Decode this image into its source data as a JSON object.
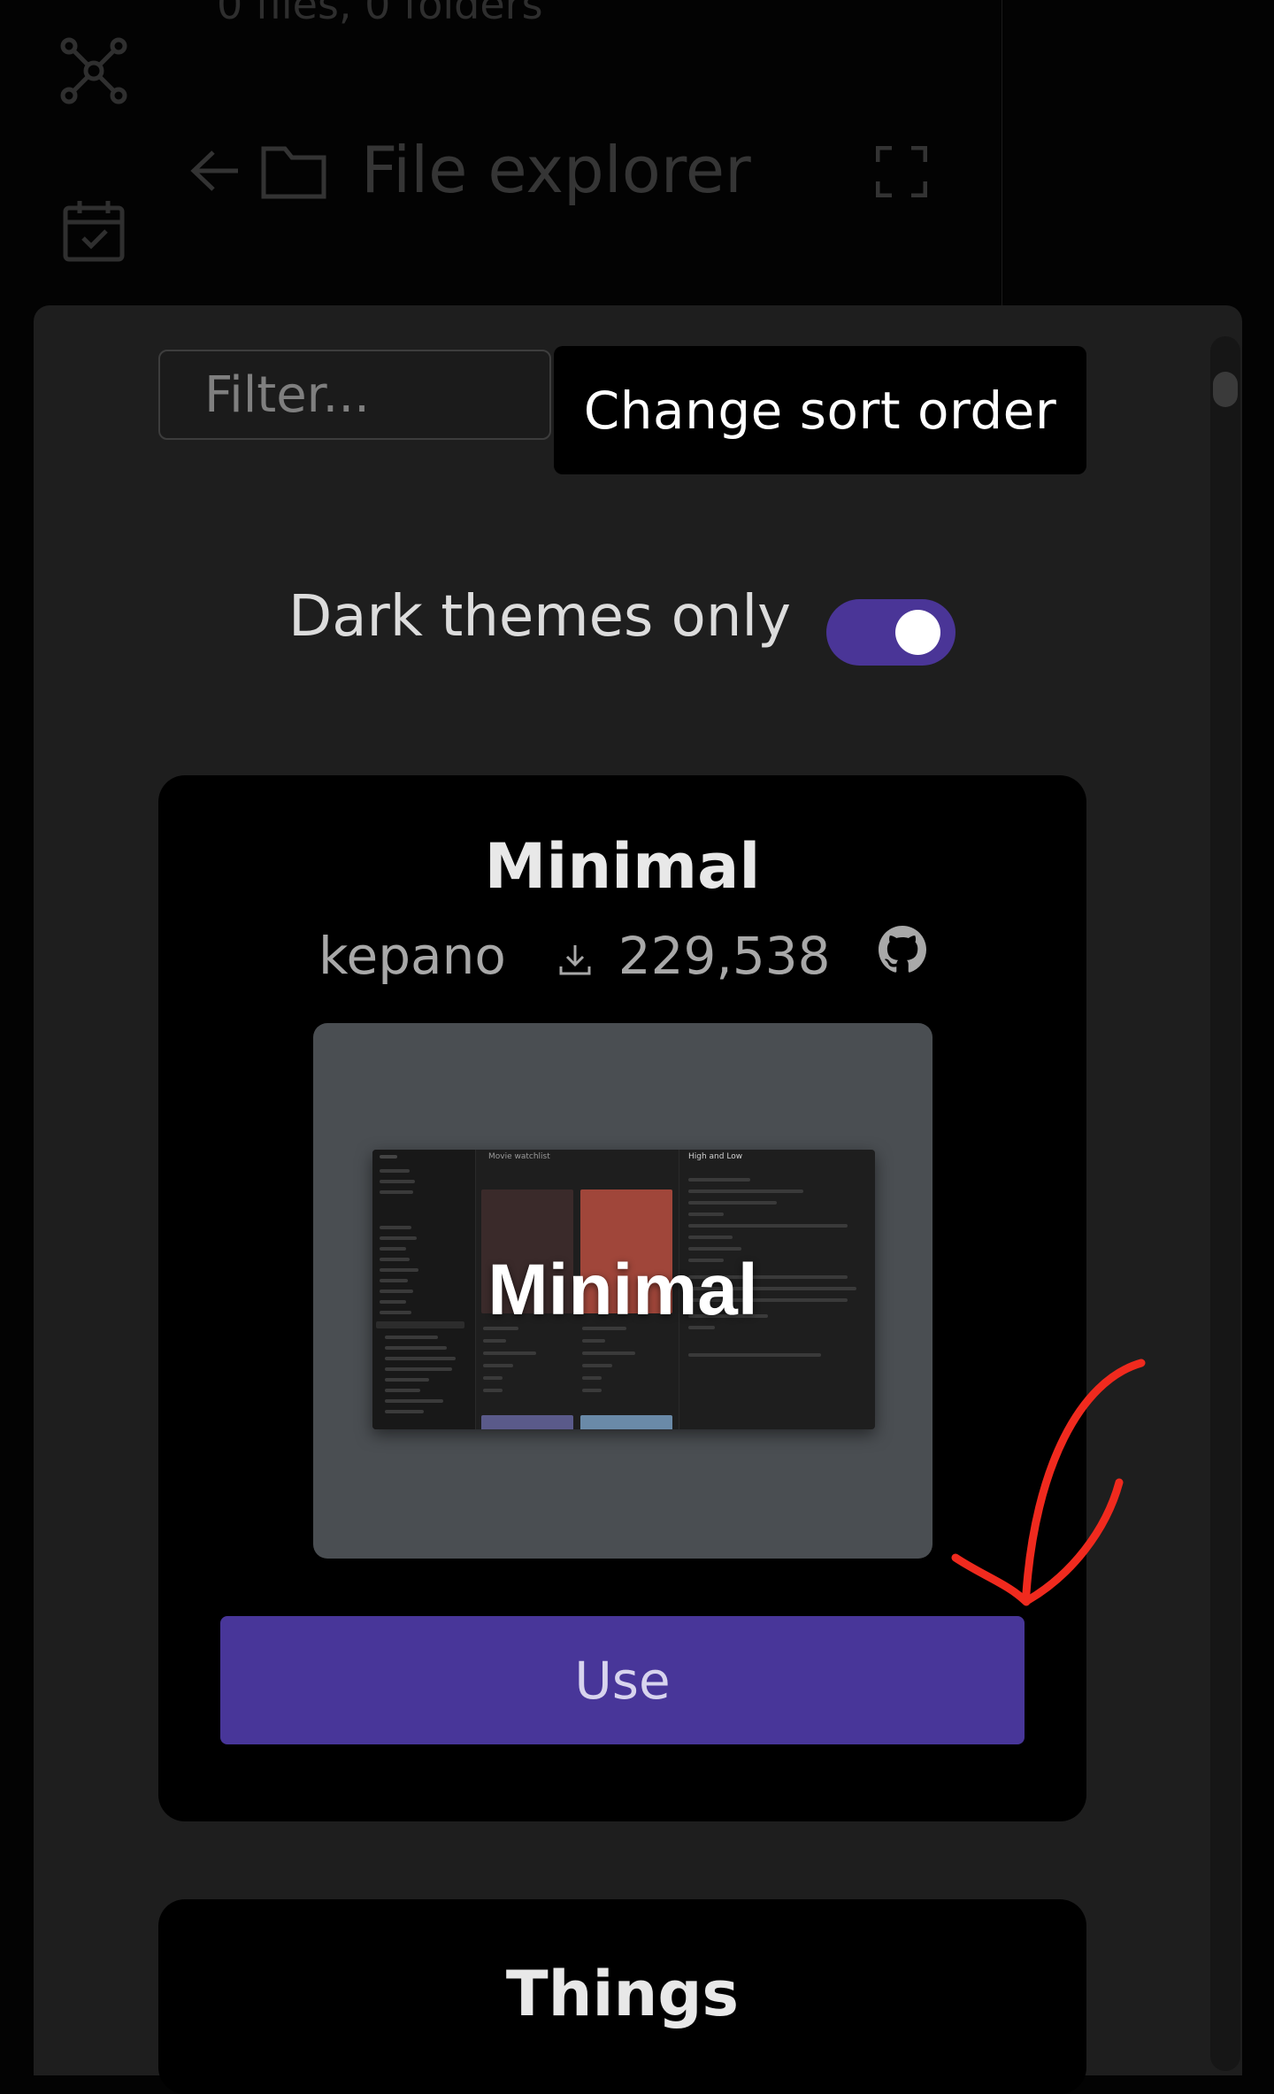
{
  "background": {
    "file_info": "0 files, 0 folders",
    "panel_title": "File explorer"
  },
  "modal": {
    "filter_placeholder": "Filter...",
    "sort_button_label": "Change sort order",
    "dark_themes_label": "Dark themes only",
    "dark_themes_enabled": true,
    "accent_color": "#483699"
  },
  "themes": [
    {
      "name": "Minimal",
      "author": "kepano",
      "downloads": "229,538",
      "preview_overlay": "Minimal",
      "preview": {
        "mid_title": "Movie watchlist",
        "right_title": "High and Low"
      },
      "use_label": "Use"
    },
    {
      "name": "Things"
    }
  ],
  "icons": {
    "ribbon": [
      "graph-icon",
      "calendar-icon"
    ],
    "download": "download-icon",
    "repo": "github-icon"
  }
}
